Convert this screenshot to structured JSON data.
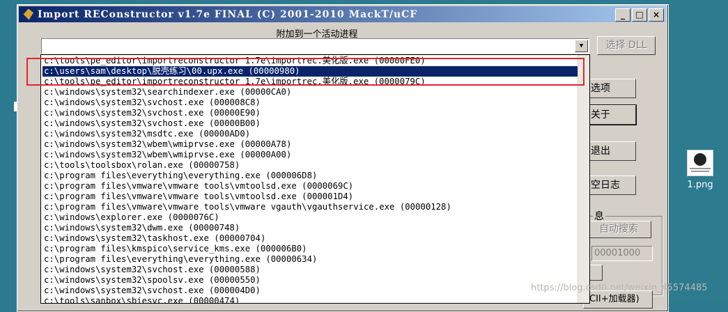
{
  "window": {
    "title": "Import REConstructor v1.7e FINAL (C) 2001-2010 MackT/uCF",
    "minimize": "_",
    "maximize": "□",
    "close": "×"
  },
  "attach": {
    "label": "附加到一个活动进程",
    "select_dll": "选择 DLL"
  },
  "buttons": {
    "options": "选项",
    "about": "关于",
    "exit": "退出",
    "clear_log": "空日志",
    "auto_search": "自动搜索",
    "partial_label": "CII+加载器)"
  },
  "group": {
    "info_label": "息",
    "oep_value": "00001000"
  },
  "processes": [
    "c:\\tools\\pe_editor\\importreconstructor 1.7e\\importrec.美化版.exe (00000FE0)",
    "c:\\users\\sam\\desktop\\脱壳练习\\00.upx.exe (00000980)",
    "c:\\tools\\pe_editor\\importreconstructor 1.7e\\importrec.美化版.exe (0000079C)",
    "c:\\windows\\system32\\searchindexer.exe (00000CA0)",
    "c:\\windows\\system32\\svchost.exe (000008C8)",
    "c:\\windows\\system32\\svchost.exe (00000E90)",
    "c:\\windows\\system32\\svchost.exe (00000B00)",
    "c:\\windows\\system32\\msdtc.exe (00000AD0)",
    "c:\\windows\\system32\\wbem\\wmiprvse.exe (00000A78)",
    "c:\\windows\\system32\\wbem\\wmiprvse.exe (00000A00)",
    "c:\\tools\\toolsbox\\rolan.exe (00000758)",
    "c:\\program files\\everything\\everything.exe (000006D8)",
    "c:\\program files\\vmware\\vmware tools\\vmtoolsd.exe (0000069C)",
    "c:\\program files\\vmware\\vmware tools\\vmtoolsd.exe (000001D4)",
    "c:\\program files\\vmware\\vmware tools\\vmware vgauth\\vgauthservice.exe (00000128)",
    "c:\\windows\\explorer.exe (0000076C)",
    "c:\\windows\\system32\\dwm.exe (00000748)",
    "c:\\windows\\system32\\taskhost.exe (00000704)",
    "c:\\program files\\kmspico\\service_kms.exe (000006B0)",
    "c:\\program files\\everything\\everything.exe (00000634)",
    "c:\\windows\\system32\\svchost.exe (00000588)",
    "c:\\windows\\system32\\spoolsv.exe (00000550)",
    "c:\\windows\\system32\\svchost.exe (000004D0)",
    "c:\\tools\\sanbox\\sbiesvc.exe (00000474)"
  ],
  "selected_index": 1,
  "desktop": {
    "icon_label": "1.png",
    "icon": "image-file-icon"
  },
  "watermark": "https://blog.csdn.net/weixin_45574485",
  "colors": {
    "title_start": "#0a246a",
    "title_end": "#a6caf0",
    "selection": "#0a246a",
    "highlight_box": "#e0262a",
    "desktop": "#2b7a8f"
  }
}
